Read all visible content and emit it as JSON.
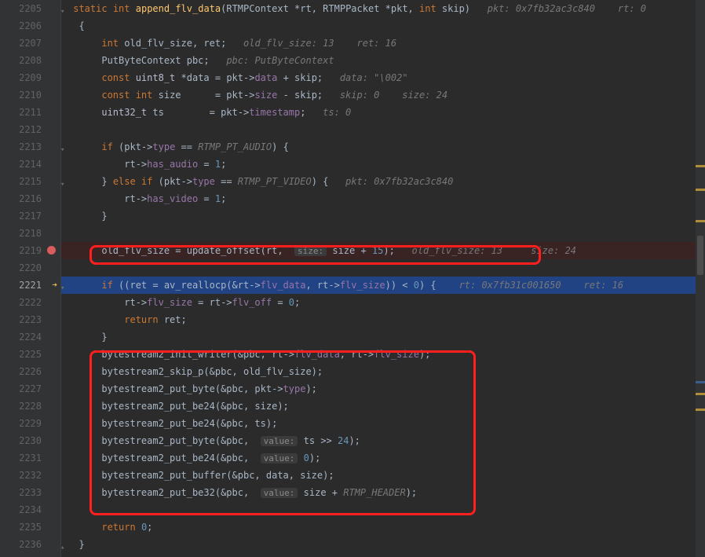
{
  "gutter": {
    "start": 2205,
    "end": 2236,
    "breakpoint_line": 2219,
    "exec_line": 2221
  },
  "hints": {
    "sig": "pkt: 0x7fb32ac3c840    rt: 0",
    "l2207": "old_flv_size: 13    ret: 16",
    "l2208": "pbc: PutByteContext",
    "l2209": "data: \"\\002\"",
    "l2210": "skip: 0    size: 24",
    "l2211": "ts: 0",
    "l2215": "pkt: 0x7fb32ac3c840",
    "l2219": "old_flv_size: 13",
    "l2219b": "size: 24",
    "l2221a": "rt: 0x7fb31c001650",
    "l2221b": "ret: 16",
    "size_lbl": "size:",
    "value_lbl": "value:"
  },
  "code": {
    "l2205_kw1": "static",
    "l2205_kw2": "int",
    "l2205_fn": "append_flv_data",
    "l2205_p": "(RTMPContext *rt, RTMPPacket *pkt, ",
    "l2205_kw3": "int",
    "l2205_p2": " skip)",
    "l2206": "{",
    "l2207_kw": "int",
    "l2207_t": " old_flv_size, ret;",
    "l2208_t1": "PutByteContext pbc;",
    "l2209_kw1": "const",
    "l2209_ty": " uint8_t ",
    "l2209_t": "*data = pkt->",
    "l2209_f": "data",
    "l2209_t2": " + skip;",
    "l2210_kw1": "const",
    "l2210_kw2": " int",
    "l2210_t": " size      = pkt->",
    "l2210_f": "size",
    "l2210_t2": " - skip;",
    "l2211_ty": "uint32_t",
    "l2211_t": " ts        = pkt->",
    "l2211_f": "timestamp",
    "l2211_t2": ";",
    "l2213_kw": "if",
    "l2213_t": " (pkt->",
    "l2213_f": "type",
    "l2213_t2": " == ",
    "l2213_c": "RTMP_PT_AUDIO",
    "l2213_t3": ") {",
    "l2214_t": "rt->",
    "l2214_f": "has_audio",
    "l2214_t2": " = ",
    "l2214_n": "1",
    "l2214_t3": ";",
    "l2215_t": "} ",
    "l2215_kw": "else if",
    "l2215_t2": " (pkt->",
    "l2215_f": "type",
    "l2215_t3": " == ",
    "l2215_c": "RTMP_PT_VIDEO",
    "l2215_t4": ") {",
    "l2216_t": "rt->",
    "l2216_f": "has_video",
    "l2216_t2": " = ",
    "l2216_n": "1",
    "l2216_t3": ";",
    "l2217": "}",
    "l2219_t": " old_flv_size = update_offset(rt, ",
    "l2219_t2": " size + ",
    "l2219_n": "15",
    "l2219_t3": ");",
    "l2221_kw": "if",
    "l2221_t": " ((ret = av_reallocp(&rt->",
    "l2221_f1": "flv_data",
    "l2221_t2": ", rt->",
    "l2221_f2": "flv_size",
    "l2221_t3": ")) < ",
    "l2221_n": "0",
    "l2221_t4": ") {",
    "l2222_t": "rt->",
    "l2222_f1": "flv_size",
    "l2222_t2": " = rt->",
    "l2222_f2": "flv_off",
    "l2222_t3": " = ",
    "l2222_n": "0",
    "l2222_t4": ";",
    "l2223_kw": "return",
    "l2223_t": " ret;",
    "l2224": "}",
    "l2225_t": "bytestream2_init_writer(&pbc, rt->",
    "l2225_f1": "flv_data",
    "l2225_t2": ", rt->",
    "l2225_f2": "flv_size",
    "l2225_t3": ");",
    "l2226": "bytestream2_skip_p(&pbc, old_flv_size);",
    "l2227_t": "bytestream2_put_byte(&pbc, pkt->",
    "l2227_f": "type",
    "l2227_t2": ");",
    "l2228": "bytestream2_put_be24(&pbc, size);",
    "l2229": "bytestream2_put_be24(&pbc, ts);",
    "l2230_t": "bytestream2_put_byte(&pbc, ",
    "l2230_t2": " ts >> ",
    "l2230_n": "24",
    "l2230_t3": ");",
    "l2231_t": "bytestream2_put_be24(&pbc, ",
    "l2231_n": "0",
    "l2231_t2": ");",
    "l2232": "bytestream2_put_buffer(&pbc, data, size);",
    "l2233_t": "bytestream2_put_be32(&pbc, ",
    "l2233_t2": " size + ",
    "l2233_c": "RTMP_HEADER",
    "l2233_t3": ");",
    "l2235_kw": "return",
    "l2235_n": " 0",
    "l2235_t": ";",
    "l2236": "}"
  }
}
